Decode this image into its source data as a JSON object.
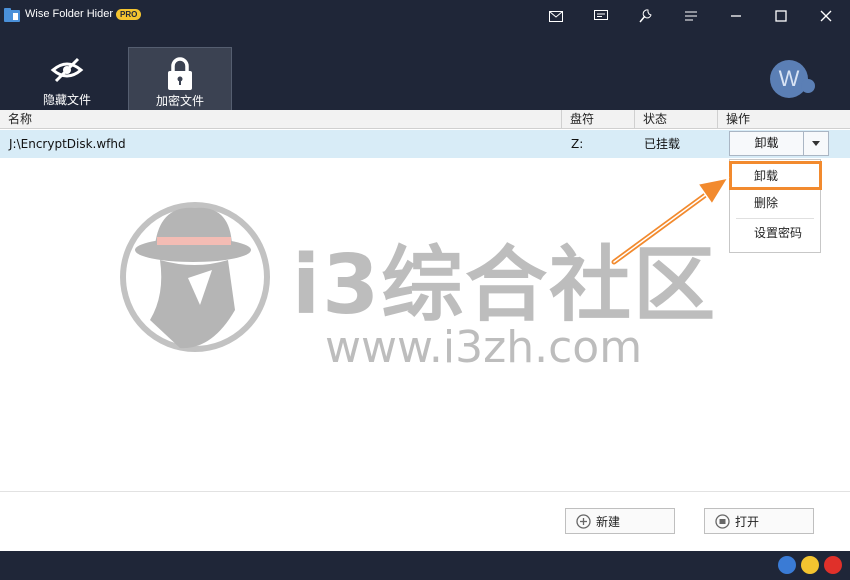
{
  "app": {
    "title": "Wise Folder Hider",
    "badge": "PRO",
    "avatar_letter": "W"
  },
  "titlebar_icons": [
    "mail-icon",
    "feedback-icon",
    "tools-icon",
    "menu-icon",
    "minimize-icon",
    "maximize-icon",
    "close-icon"
  ],
  "tabs": [
    {
      "label": "隐藏文件",
      "icon": "hidden-eye-icon",
      "active": false
    },
    {
      "label": "加密文件",
      "icon": "lock-icon",
      "active": true
    }
  ],
  "table": {
    "columns": [
      "名称",
      "盘符",
      "状态",
      "操作"
    ],
    "rows": [
      {
        "name": "J:\\EncryptDisk.wfhd",
        "drive": "Z:",
        "status": "已挂载",
        "action": "卸载"
      }
    ]
  },
  "dropdown": {
    "items": [
      "卸载",
      "删除",
      "设置密码"
    ],
    "highlighted": "卸载"
  },
  "watermark": {
    "title": "i3综合社区",
    "url": "www.i3zh.com"
  },
  "footer": {
    "new_button": "新建",
    "open_button": "打开"
  },
  "colors": {
    "header_bg": "#1f2638",
    "row_selected": "#d8ecf7",
    "highlight_orange": "#f28a2e",
    "badge_yellow": "#f4c430"
  }
}
